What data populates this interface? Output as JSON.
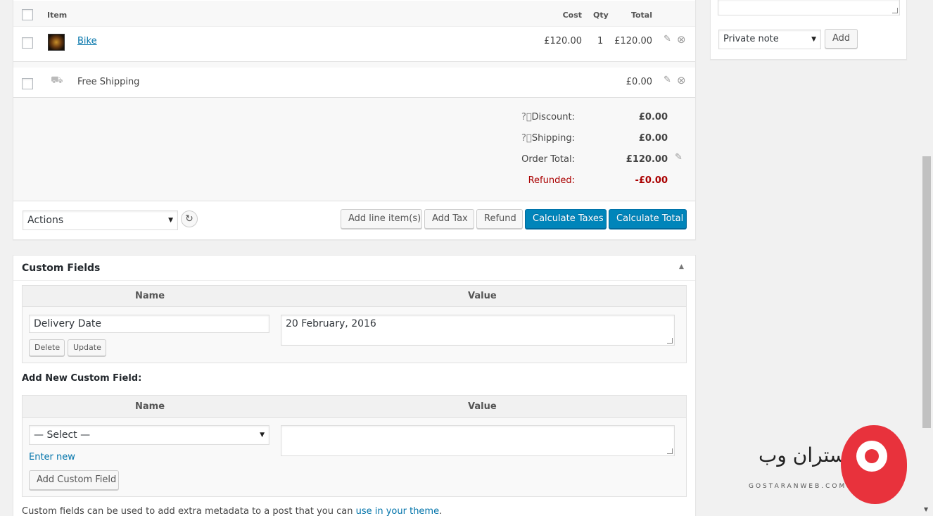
{
  "items_table": {
    "headers": {
      "item": "Item",
      "cost": "Cost",
      "qty": "Qty",
      "total": "Total"
    },
    "line_item": {
      "name": "Bike",
      "cost": "£120.00",
      "qty": "1",
      "total": "£120.00"
    },
    "shipping": {
      "name": "Free Shipping",
      "total": "£0.00"
    }
  },
  "totals": {
    "discount_label": "Discount:",
    "discount_value": "£0.00",
    "shipping_label": "Shipping:",
    "shipping_value": "£0.00",
    "order_total_label": "Order Total:",
    "order_total_value": "£120.00",
    "refunded_label": "Refunded:",
    "refunded_value": "-£0.00",
    "refunded_color": "#a00"
  },
  "actions_bar": {
    "actions_select": "Actions",
    "add_line_items": "Add line item(s)",
    "add_tax": "Add Tax",
    "refund": "Refund",
    "calculate_taxes": "Calculate Taxes",
    "calculate_total": "Calculate Total"
  },
  "notes": {
    "note_type": "Private note",
    "add_button": "Add"
  },
  "custom_fields": {
    "title": "Custom Fields",
    "name_header": "Name",
    "value_header": "Value",
    "existing": {
      "name": "Delivery Date",
      "value": "20 February, 2016"
    },
    "delete_button": "Delete",
    "update_button": "Update",
    "add_new_label": "Add New Custom Field:",
    "select_placeholder": "— Select —",
    "enter_new": "Enter new",
    "add_button": "Add Custom Field",
    "footer_text": "Custom fields can be used to add extra metadata to a post that you can ",
    "footer_link": "use in your theme",
    "footer_end": "."
  },
  "watermark": {
    "brand": "گستران وب",
    "domain": "GOSTARANWEB.COM",
    "accent": "#e8323c"
  },
  "colors": {
    "primary": "#0085ba",
    "link": "#0073aa"
  }
}
